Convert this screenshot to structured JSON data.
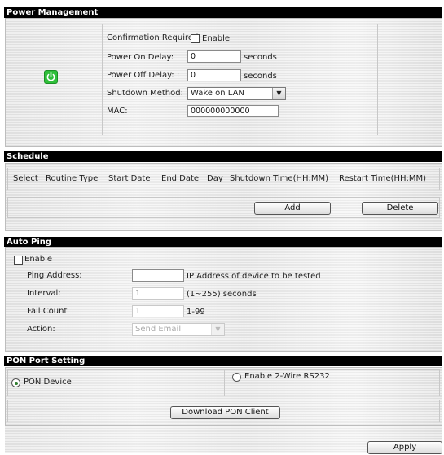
{
  "power_management": {
    "title": "Power Management",
    "icon": "power-icon",
    "confirmation_required_label": "Confirmation Required",
    "enable_label": "Enable",
    "power_on_delay_label": "Power On Delay:",
    "power_on_delay_value": "0",
    "power_off_delay_label": "Power Off Delay: :",
    "power_off_delay_value": "0",
    "seconds_label": "seconds",
    "shutdown_method_label": "Shutdown Method:",
    "shutdown_method_value": "Wake on LAN",
    "mac_label": "MAC:",
    "mac_value": "000000000000"
  },
  "schedule": {
    "title": "Schedule",
    "columns": [
      "Select",
      "Routine Type",
      "Start Date",
      "End Date",
      "Day",
      "Shutdown Time(HH:MM)",
      "Restart Time(HH:MM)"
    ],
    "add_label": "Add",
    "delete_label": "Delete"
  },
  "auto_ping": {
    "title": "Auto Ping",
    "enable_label": "Enable",
    "ping_address_label": "Ping Address:",
    "ping_address_value": "",
    "ping_address_hint": "IP Address of device to be tested",
    "interval_label": "Interval:",
    "interval_value": "1",
    "interval_hint": "(1~255) seconds",
    "fail_count_label": "Fail Count",
    "fail_count_value": "1",
    "fail_count_hint": "1-99",
    "action_label": "Action:",
    "action_value": "Send Email"
  },
  "pon_port": {
    "title": "PON Port Setting",
    "pon_device_label": "PON Device",
    "enable_2wire_label": "Enable 2-Wire RS232",
    "download_label": "Download PON Client"
  },
  "apply_label": "Apply",
  "colors": {
    "header_bg": "#000000",
    "power_icon_green": "#2fbf3a"
  }
}
